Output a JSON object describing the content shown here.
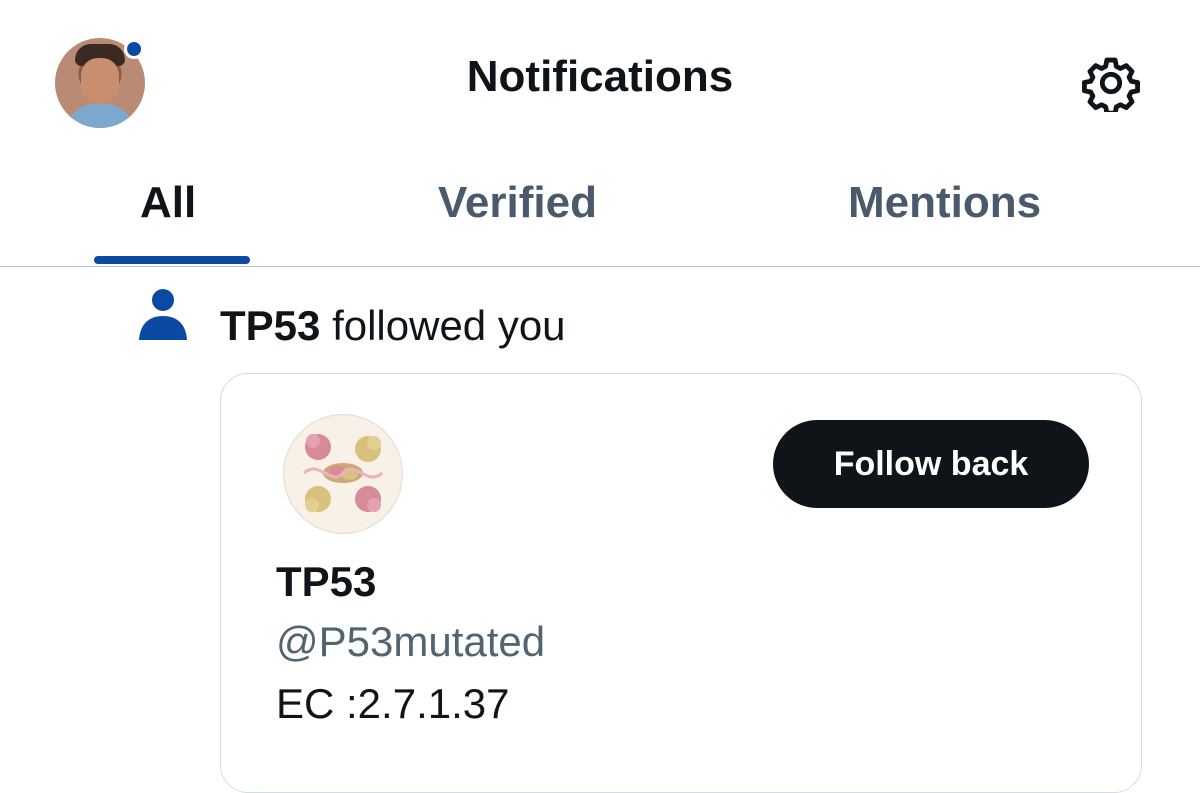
{
  "header": {
    "title": "Notifications",
    "avatar_icon": "user-avatar",
    "settings_icon": "gear-icon"
  },
  "tabs": [
    {
      "label": "All",
      "active": true
    },
    {
      "label": "Verified",
      "active": false
    },
    {
      "label": "Mentions",
      "active": false
    }
  ],
  "notification": {
    "icon": "person-icon",
    "actor": "TP53",
    "action": "followed you"
  },
  "card": {
    "name": "TP53",
    "handle": "@P53mutated",
    "bio": "EC :2.7.1.37",
    "follow_label": "Follow back"
  },
  "colors": {
    "accent": "#0b4aa2",
    "text_primary": "#0f1419",
    "text_secondary": "#536471",
    "button_bg": "#0f1419"
  }
}
